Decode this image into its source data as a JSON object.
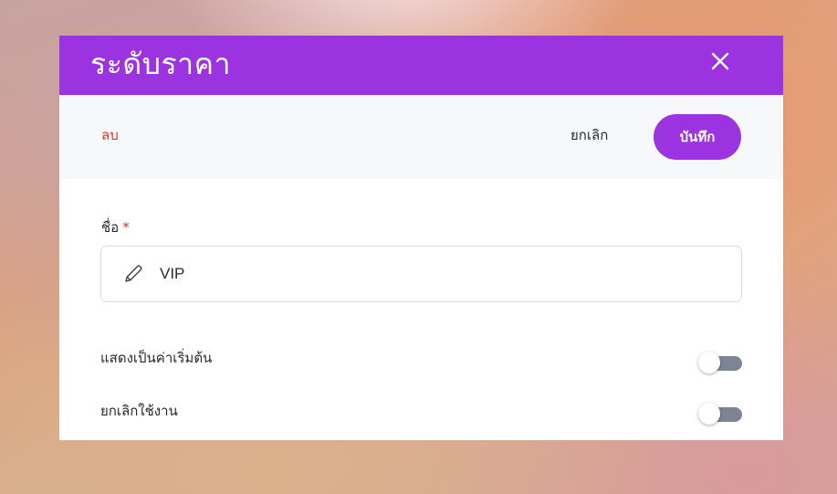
{
  "dialog": {
    "title": "ระดับราคา",
    "close_icon": "close-icon",
    "header_color": "#9b33e0"
  },
  "toolbar": {
    "delete_label": "ลบ",
    "cancel_label": "ยกเลิก",
    "save_label": "บันทึก",
    "delete_color": "#d8342f",
    "save_color": "#9b33e0"
  },
  "form": {
    "name": {
      "label": "ชื่อ",
      "required_mark": "*",
      "value": "VIP",
      "icon": "pencil-icon"
    },
    "toggles": [
      {
        "label": "แสดงเป็นค่าเริ่มต้น",
        "on": false
      },
      {
        "label": "ยกเลิกใช้งาน",
        "on": false
      }
    ]
  }
}
